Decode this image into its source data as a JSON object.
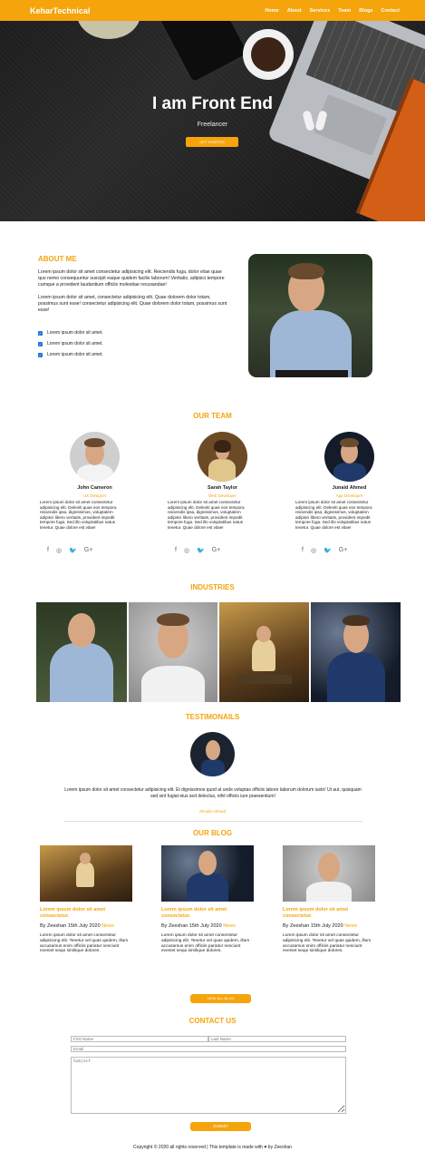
{
  "nav": {
    "brand": "KeharTechnical",
    "items": [
      "Home",
      "About",
      "Services",
      "Team",
      "Blogs",
      "Contact"
    ]
  },
  "hero": {
    "title": "I am Front End",
    "subtitle": "Freelancer",
    "button": "GET STARTED"
  },
  "about": {
    "title": "ABOUT ME",
    "paragraph1": "Lorem ipsum dolor sit amet consectetur adipisicing elit. Reiciendis fuga, dolor vitae quae quo nemo consequuntur suscipit eaque quidem facilis laborum! Veritatis, adipisci tempore cumque a provident laudantium officiis molestiae recusandae!",
    "paragraph2": "Lorem ipsum dolor sit amet, consectetur adipisicing elit. Quae dolorem dolor totam, possimus sunt esse! consectetur adipisicing elit. Quae dolorem dolor totam, possimus sunt esse!",
    "checks": [
      "Lorem ipsum dolor sit amet.",
      "Lorem ipsum dolor sit amet.",
      "Lorem ipsum dolor sit amet."
    ]
  },
  "team": {
    "title": "OUR TEAM",
    "members": [
      {
        "name": "John Cameron",
        "role": "UX Designer",
        "desc": "Lorem ipsum dolor sit amet consectetur adipisicing elit. Deleniti quas eos tempora reiciendis ipsa, dignissimos, voluptatem adipisci libero veritatis, provident impedit tempore fuga. Sed illo voluptatibus natus tenetur. Quae dolore est vitae!"
      },
      {
        "name": "Sarah Taylor",
        "role": "Web Developer",
        "desc": "Lorem ipsum dolor sit amet consectetur adipisicing elit. Deleniti quas eos tempora reiciendis ipsa, dignissimos, voluptatem adipisci libero veritatis, provident impedit tempore fuga. Sed illo voluptatibus natus tenetur. Quae dolore est vitae!"
      },
      {
        "name": "Junaid Ahmed",
        "role": "App Developer",
        "desc": "Lorem ipsum dolor sit amet consectetur adipisicing elit. Deleniti quas eos tempora reiciendis ipsa, dignissimos, voluptatem adipisci libero veritatis, provident impedit tempore fuga. Sed illo voluptatibus natus tenetur. Quae dolore est vitae!"
      }
    ],
    "social_icons": [
      "f",
      "◎",
      "🐦",
      "G+"
    ]
  },
  "industries": {
    "title": "INDUSTRIES"
  },
  "testimonials": {
    "title": "TESTIMONAILS",
    "text": "Lorem ipsum dolor sit amet consectetur adipisicing elit. Et dignissimos quod at unde voluptas officiis labore laborum dolorum iusto! Ut aut, quisquam sed sint fugiat eius sed delectus, nihil officiis iure praesentium!",
    "name": "Shoaib Ahmad"
  },
  "blog": {
    "title": "OUR BLOG",
    "posts": [
      {
        "title": "Lorem ipsum dolor sit amet consectetur.",
        "by": "By Zeeshan 15th July 2020",
        "cat": "News",
        "desc": "Lorem ipsum dolor sit amet consectetur adipisicing elit. Tenetur vel quas quidem, illum accusamus enim officiis pariatur nesciunt eveniet sequi similique dolores."
      },
      {
        "title": "Lorem ipsum dolor sit amet consectetur.",
        "by": "By Zeeshan 15th July 2020",
        "cat": "News",
        "desc": "Lorem ipsum dolor sit amet consectetur adipisicing elit. Tenetur vel quas quidem, illum accusamus enim officiis pariatur nesciunt eveniet sequi similique dolores."
      },
      {
        "title": "Lorem ipsum dolor sit amet consectetur.",
        "by": "By Zeeshan 15th July 2020",
        "cat": "News",
        "desc": "Lorem ipsum dolor sit amet consectetur adipisicing elit. Tenetur vel quas quidem, illum accusamus enim officiis pariatur nesciunt eveniet sequi similique dolores."
      }
    ],
    "button": "VIEW ALL BLOG"
  },
  "contact": {
    "title": "CONTACT US",
    "first_name_placeholder": "First Name",
    "last_name_placeholder": "Last Name",
    "email_placeholder": "Email",
    "subject_placeholder": "Subject",
    "submit": "SUBMIT"
  },
  "footer": "Copyright © 2020 all rights reserved | This template is made with ♥ by Zeeshan",
  "colors": {
    "accent": "#f5a40b",
    "link": "#1e73d8"
  }
}
